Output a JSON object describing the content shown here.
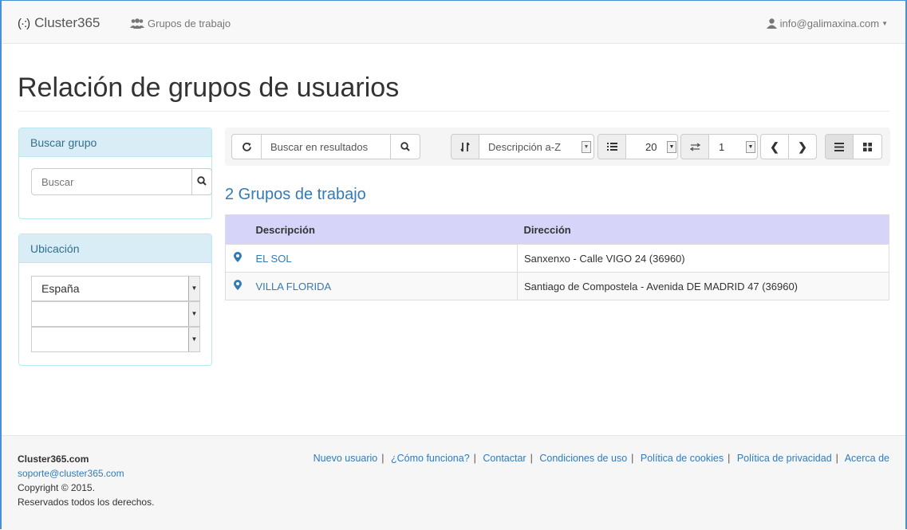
{
  "navbar": {
    "brand_logo": "(·:)",
    "brand": "Cluster365",
    "nav_link": "Grupos de trabajo",
    "user": "info@galimaxina.com"
  },
  "page": {
    "title": "Relación de grupos de usuarios"
  },
  "search_panel": {
    "heading": "Buscar grupo",
    "input_placeholder": "Buscar"
  },
  "location_panel": {
    "heading": "Ubicación",
    "country": "España",
    "region": "",
    "city": ""
  },
  "toolbar": {
    "search_placeholder": "Buscar en resultados",
    "sort_value": "Descripción a-Z",
    "page_size": "20",
    "page": "1"
  },
  "results": {
    "count_label": "2 Grupos de trabajo",
    "columns": [
      "Descripción",
      "Dirección"
    ],
    "rows": [
      {
        "name": "EL SOL",
        "address": "Sanxenxo - Calle VIGO 24 (36960)"
      },
      {
        "name": "VILLA FLORIDA",
        "address": "Santiago de Compostela - Avenida DE MADRID 47 (36960)"
      }
    ]
  },
  "footer": {
    "brand": "Cluster365.com",
    "email": "soporte@cluster365.com",
    "copyright": "Copyright © 2015.",
    "rights": "Reservados todos los derechos.",
    "links": [
      "Nuevo usuario",
      "¿Cómo funciona?",
      "Contactar",
      "Condiciones de uso",
      "Política de cookies",
      "Política de privacidad",
      "Acerca de"
    ]
  }
}
